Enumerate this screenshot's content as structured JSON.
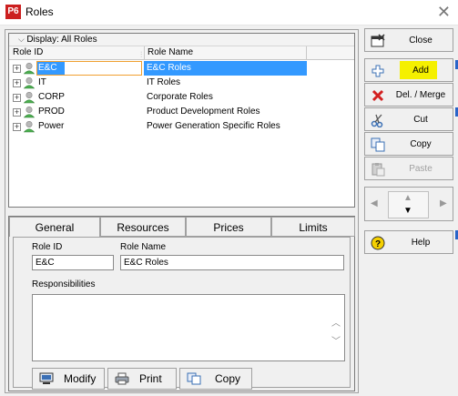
{
  "window": {
    "logo": "P6",
    "title": "Roles",
    "close_glyph": "✕"
  },
  "grid": {
    "display_label": "Display: All Roles",
    "columns": {
      "id": "Role ID",
      "name": "Role Name"
    },
    "rows": [
      {
        "id": "E&C",
        "name": "E&C Roles",
        "selected": true
      },
      {
        "id": "IT",
        "name": "IT Roles"
      },
      {
        "id": "CORP",
        "name": "Corporate Roles"
      },
      {
        "id": "PROD",
        "name": "Product Development Roles"
      },
      {
        "id": "Power",
        "name": "Power Generation Specific Roles"
      }
    ]
  },
  "tabs": [
    {
      "label": "General",
      "active": true
    },
    {
      "label": "Resources"
    },
    {
      "label": "Prices"
    },
    {
      "label": "Limits"
    }
  ],
  "general": {
    "role_id_label": "Role ID",
    "role_id_value": "E&C",
    "role_name_label": "Role Name",
    "role_name_value": "E&C Roles",
    "responsibilities_label": "Responsibilities",
    "responsibilities_value": ""
  },
  "bottom_buttons": {
    "modify": "Modify",
    "print": "Print",
    "copy": "Copy"
  },
  "toolbar": {
    "close": "Close",
    "add": "Add",
    "del_merge": "Del. / Merge",
    "cut": "Cut",
    "copy": "Copy",
    "paste": "Paste",
    "help": "Help"
  },
  "colors": {
    "selection": "#3399ff",
    "highlight": "#f5f000",
    "logo": "#cc1f1f"
  }
}
